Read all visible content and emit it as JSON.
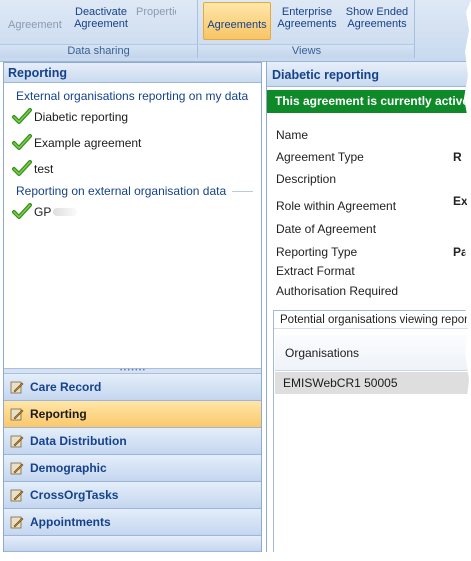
{
  "ribbon": {
    "groups": [
      {
        "label": "Data sharing",
        "buttons": [
          "Agreement",
          "Deactivate Agreement",
          "Properties"
        ]
      },
      {
        "label": "Views",
        "buttons": [
          "Agreements",
          "Enterprise Agreements",
          "Show Ended Agreements"
        ]
      }
    ]
  },
  "left_panel": {
    "title": "Reporting",
    "section1": "External organisations reporting on my data",
    "section1_items": [
      "Diabetic reporting",
      "Example agreement",
      "test"
    ],
    "section2": "Reporting on external organisation data",
    "section2_items": [
      "GP"
    ]
  },
  "nav": [
    {
      "label": "Care Record",
      "icon": "pencil-icon"
    },
    {
      "label": "Reporting",
      "icon": "pencil-icon"
    },
    {
      "label": "Data Distribution",
      "icon": "pencil-icon"
    },
    {
      "label": "Demographic",
      "icon": "pencil-icon"
    },
    {
      "label": "CrossOrgTasks",
      "icon": "pencil-icon"
    },
    {
      "label": "Appointments",
      "icon": "pencil-icon"
    }
  ],
  "right_panel": {
    "title": "Diabetic reporting",
    "banner": "This agreement is currently active",
    "fields": [
      "Name",
      "Agreement Type",
      "Description",
      "Role within Agreement",
      "Date of Agreement",
      "Reporting Type",
      "Extract Format",
      "Authorisation Required"
    ],
    "values": {
      "agreement_type": "R",
      "role": "Ex",
      "reporting_type": "Pa"
    },
    "org_box_title": "Potential organisations viewing reports",
    "org_header": "Organisations",
    "org_rows": [
      "EMISWebCR1 50005"
    ]
  },
  "colors": {
    "accent": "#15428b",
    "banner": "#0f8a29",
    "active_nav": "#fbc86a"
  }
}
